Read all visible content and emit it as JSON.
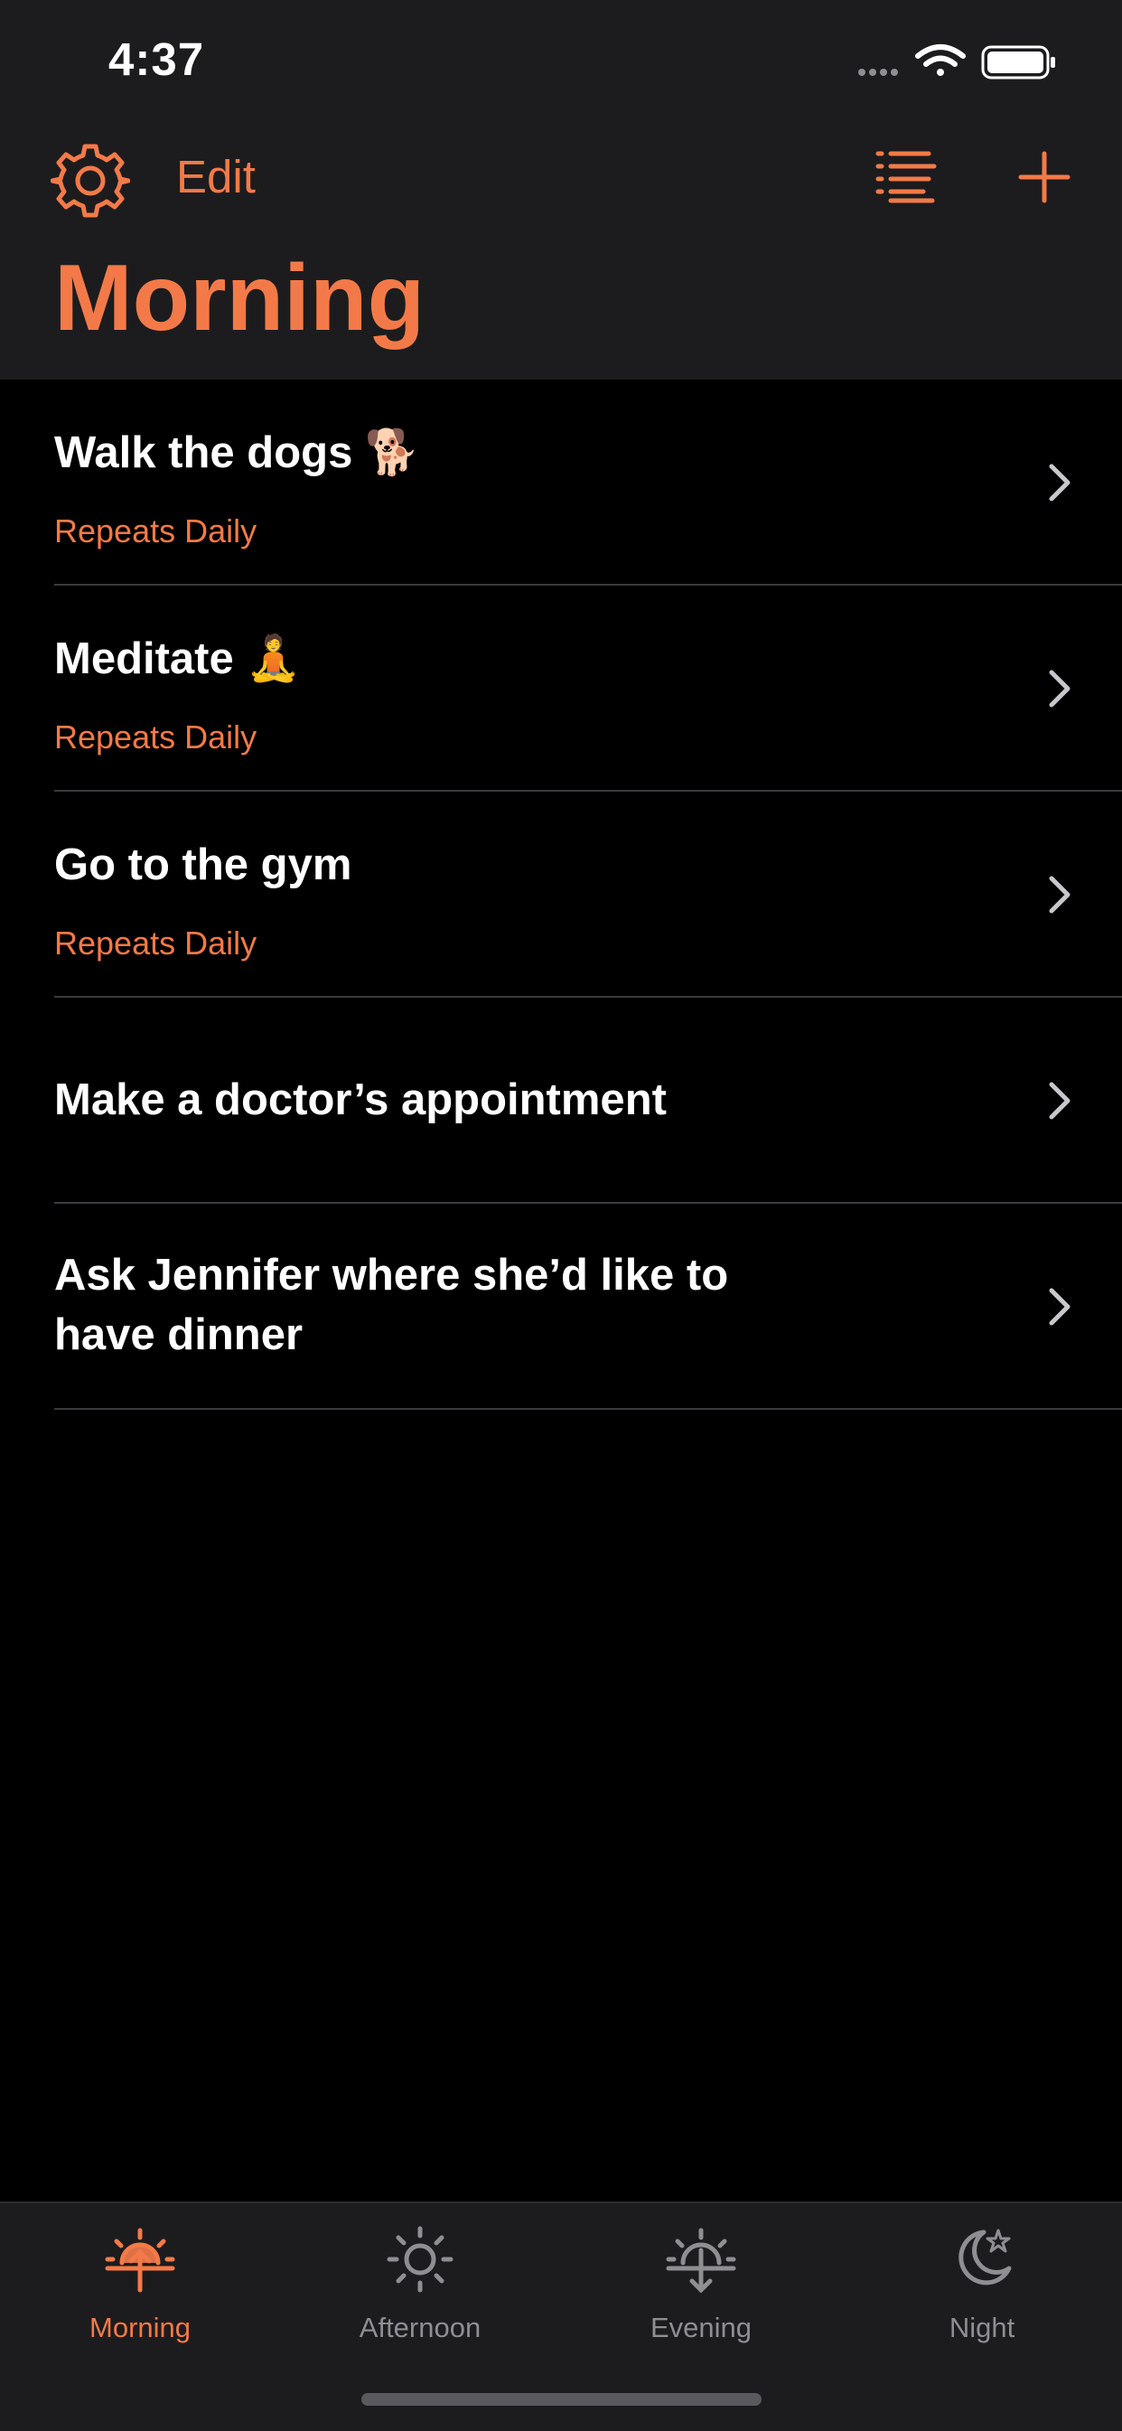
{
  "status_bar": {
    "time": "4:37"
  },
  "nav": {
    "edit_label": "Edit",
    "title": "Morning",
    "settings_icon": "gear-icon",
    "list_icon": "list-icon",
    "add_icon": "plus-icon"
  },
  "colors": {
    "accent": "#f37a48",
    "background": "#000000",
    "bar_background": "#1c1c1e",
    "separator": "#3a3a3c",
    "inactive": "#8e8e93"
  },
  "tasks": [
    {
      "title": "Walk the dogs 🐕",
      "subtitle": "Repeats Daily"
    },
    {
      "title": "Meditate 🧘",
      "subtitle": "Repeats Daily"
    },
    {
      "title": "Go to the gym",
      "subtitle": "Repeats Daily"
    },
    {
      "title": "Make a doctor’s appointment",
      "subtitle": ""
    },
    {
      "title": "Ask Jennifer where she’d like to have dinner",
      "subtitle": ""
    }
  ],
  "tabs": [
    {
      "label": "Morning",
      "icon": "sunrise-icon",
      "active": true
    },
    {
      "label": "Afternoon",
      "icon": "sun-icon",
      "active": false
    },
    {
      "label": "Evening",
      "icon": "sunset-icon",
      "active": false
    },
    {
      "label": "Night",
      "icon": "moon-icon",
      "active": false
    }
  ]
}
